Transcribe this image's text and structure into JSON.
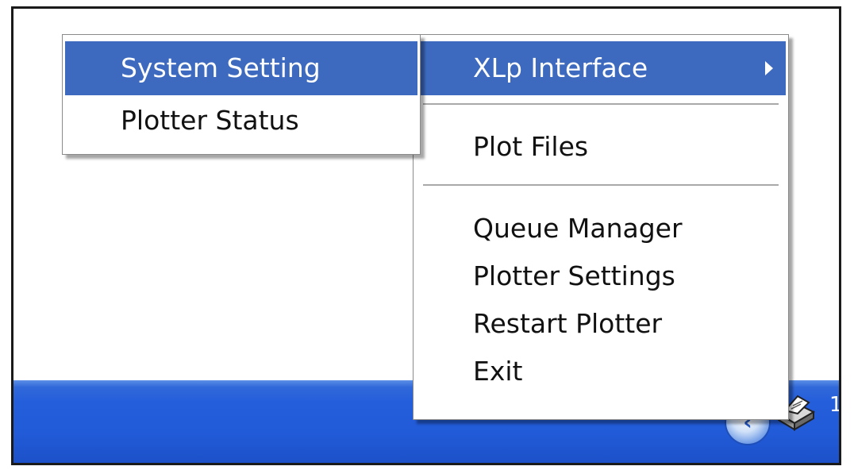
{
  "tray": {
    "back_button_icon": "chevron-left-icon",
    "printer_icon": "printer-icon",
    "clock_text": "1"
  },
  "main_menu": {
    "items": [
      {
        "label": "XLp Interface",
        "icon": "submenu-arrow-icon",
        "selected": true
      },
      {
        "label": "Plot Files"
      },
      {
        "label": "Queue Manager"
      },
      {
        "label": "Plotter Settings"
      },
      {
        "label": "Restart Plotter"
      },
      {
        "label": "Exit"
      }
    ]
  },
  "submenu": {
    "items": [
      {
        "label": "System Setting",
        "selected": true
      },
      {
        "label": "Plotter Status"
      }
    ]
  },
  "colors": {
    "selection": "#3d6abf",
    "taskbar": "#245edb"
  }
}
